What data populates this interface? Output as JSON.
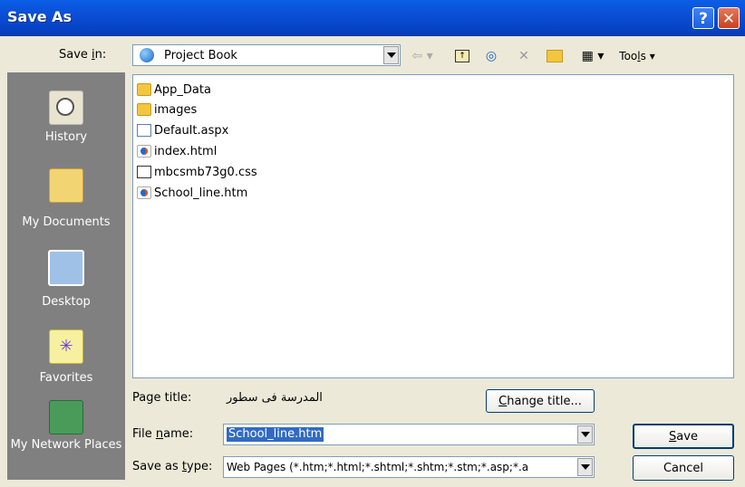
{
  "window": {
    "title": "Save As"
  },
  "toolbar": {
    "save_in_label": "Save in:",
    "save_in_value": "Project Book",
    "tools_label": "Tools"
  },
  "places": [
    {
      "label": "History",
      "icon": "history-icon"
    },
    {
      "label": "My Documents",
      "icon": "my-documents-icon"
    },
    {
      "label": "Desktop",
      "icon": "desktop-icon"
    },
    {
      "label": "Favorites",
      "icon": "favorites-icon"
    },
    {
      "label": "My Network Places",
      "icon": "network-places-icon"
    }
  ],
  "files": [
    {
      "name": "App_Data",
      "type": "folder"
    },
    {
      "name": "images",
      "type": "folder"
    },
    {
      "name": "Default.aspx",
      "type": "aspx"
    },
    {
      "name": "index.html",
      "type": "html"
    },
    {
      "name": "mbcsmb73g0.css",
      "type": "css"
    },
    {
      "name": "School_line.htm",
      "type": "html"
    }
  ],
  "form": {
    "page_title_label": "Page title:",
    "page_title_value": "المدرسة فى سطور",
    "change_title_button": "Change title...",
    "file_name_label": "File name:",
    "file_name_value": "School_line.htm",
    "save_type_label": "Save as type:",
    "save_type_value": "Web Pages (*.htm;*.html;*.shtml;*.shtm;*.stm;*.asp;*.a"
  },
  "buttons": {
    "save": "Save",
    "cancel": "Cancel"
  },
  "colors": {
    "titlebar": "#0b4fd6",
    "places_bg": "#808080",
    "dialog_bg": "#ece9d8",
    "selection": "#316ac5"
  }
}
